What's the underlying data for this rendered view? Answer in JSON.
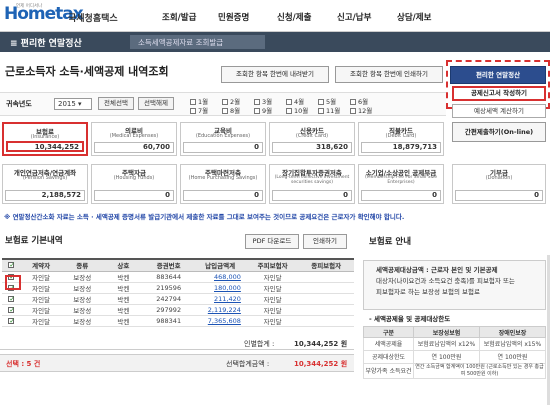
{
  "header": {
    "logo_main": "Hometax",
    "logo_sub": "언제 어디서나",
    "logo_kr": "국세청홈택스",
    "nav": [
      "조회/발급",
      "민원증명",
      "신청/제출",
      "신고/납부",
      "상담/제보"
    ]
  },
  "navbar": {
    "menu": "≡  편리한 연말정산",
    "crumb": "소득세액공제자료 조회발급"
  },
  "page_title": "근로소득자 소득·세액공제 내역조회",
  "buttons": {
    "download_all": "조회한 항목 한번에 내려받기",
    "print_all": "조회한 항목 한번에 인쇄하기",
    "easy": "편리한 연말정산",
    "write_report": "공제신고서 작성하기",
    "calc_tax": "예상세액 계산하기",
    "simplified": "간편제출하기(On-line)"
  },
  "filter": {
    "year_label": "귀속년도",
    "year": "2015",
    "select_all": "전체선택",
    "deselect": "선택해제",
    "months": [
      "1월",
      "2월",
      "3월",
      "4월",
      "5월",
      "6월",
      "7월",
      "8월",
      "9월",
      "10월",
      "11월",
      "12월"
    ]
  },
  "cards": [
    {
      "name": "보험료",
      "en": "(Insurance)",
      "value": "10,344,252"
    },
    {
      "name": "의료비",
      "en": "(Medical Expenses)",
      "value": "60,700"
    },
    {
      "name": "교육비",
      "en": "(Education Expenses)",
      "value": "0"
    },
    {
      "name": "신용카드",
      "en": "(Credit Card)",
      "value": "318,620"
    },
    {
      "name": "직불카드",
      "en": "(Debit Card)",
      "value": "18,879,713"
    },
    {
      "name": "개인연금저축/연금계좌",
      "en": "(Pension Savings)",
      "value": "2,188,572"
    },
    {
      "name": "주택자금",
      "en": "(Housing Funds)",
      "value": "0"
    },
    {
      "name": "주택마련저축",
      "en": "(Home Purchasing Savings)",
      "value": "0"
    },
    {
      "name": "장기집합투자증권저축",
      "en": "(Long-term collective investment securities savings)",
      "value": "0"
    },
    {
      "name": "소기업/소상공인 공제부금",
      "en": "(Membership Fee For Small Size Enterprises)",
      "value": "0"
    },
    {
      "name": "기부금",
      "en": "(Donation)",
      "value": "0"
    }
  ],
  "notice": "※ 연말정산간소화 자료는 소득 · 세액공제 증명서류 발급기관에서 제출한 자료를 그대로 보여주는 것이므로 공제요건은 근로자가 확인해야 합니다.",
  "table": {
    "title": "보험료 기본내역",
    "pdf_btn": "PDF 다운로드",
    "print_btn": "인쇄하기",
    "headers": [
      "",
      "계약자",
      "종류",
      "상호",
      "증권번호",
      "납입금액계",
      "주피보험자",
      "종피보험자"
    ],
    "rows": [
      [
        "자인달",
        "보장성",
        "박켄",
        "883644",
        "468,000",
        "자인달",
        ""
      ],
      [
        "자인달",
        "보장성",
        "박켄",
        "219596",
        "180,000",
        "자인달",
        ""
      ],
      [
        "자인달",
        "보장성",
        "박켄",
        "242794",
        "211,420",
        "자인달",
        ""
      ],
      [
        "자인달",
        "보장성",
        "박켄",
        "297992",
        "2,119,224",
        "자인달",
        ""
      ],
      [
        "자인달",
        "보장성",
        "박켄",
        "988341",
        "7,365,608",
        "자인달",
        ""
      ]
    ],
    "sum_label": "인별합계 :",
    "sum_value": "10,344,252 원",
    "selected_label": "선택 : 5 건",
    "selected_sum_label": "선택합계금액 :",
    "selected_sum_value": "10,344,252 원"
  },
  "guide": {
    "title": "보험료 안내",
    "text1": "세액공제대상금액 : 근로자 본인 및 기본공제",
    "text2": "대상자(나이요건과 소득요건 충족)를 피보험자 또는",
    "text3": "피보험자로 하는 보장성 보험의 보험료",
    "sub": "- 세액공제율 및 공제대상한도",
    "headers": [
      "구분",
      "보장성보험",
      "장애인보장"
    ],
    "rows": [
      [
        "세액공제율",
        "보험료납입액의 x12%",
        "보험료납입액의 x15%"
      ],
      [
        "공제대상한도",
        "연 100만원",
        "연 100만원"
      ],
      [
        "부양가족 소득요건",
        "연간 소득금액 합계액이 100만원 (근로소득만 있는 경우 총급여 500만원 이하)",
        ""
      ]
    ]
  }
}
